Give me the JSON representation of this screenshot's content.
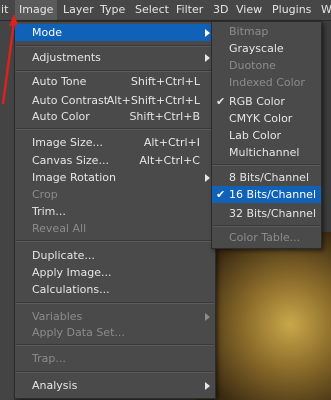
{
  "menubar": {
    "items": [
      {
        "label": "lit"
      },
      {
        "label": "Image"
      },
      {
        "label": "Layer"
      },
      {
        "label": "Type"
      },
      {
        "label": "Select"
      },
      {
        "label": "Filter"
      },
      {
        "label": "3D"
      },
      {
        "label": "View"
      },
      {
        "label": "Plugins"
      },
      {
        "label": "W"
      }
    ]
  },
  "image_menu": {
    "items": [
      {
        "label": "Mode"
      },
      {
        "label": "Adjustments"
      },
      {
        "label": "Auto Tone",
        "shortcut": "Shift+Ctrl+L"
      },
      {
        "label": "Auto Contrast",
        "shortcut": "Alt+Shift+Ctrl+L"
      },
      {
        "label": "Auto Color",
        "shortcut": "Shift+Ctrl+B"
      },
      {
        "label": "Image Size...",
        "shortcut": "Alt+Ctrl+I"
      },
      {
        "label": "Canvas Size...",
        "shortcut": "Alt+Ctrl+C"
      },
      {
        "label": "Image Rotation"
      },
      {
        "label": "Crop"
      },
      {
        "label": "Trim..."
      },
      {
        "label": "Reveal All"
      },
      {
        "label": "Duplicate..."
      },
      {
        "label": "Apply Image..."
      },
      {
        "label": "Calculations..."
      },
      {
        "label": "Variables"
      },
      {
        "label": "Apply Data Set..."
      },
      {
        "label": "Trap..."
      },
      {
        "label": "Analysis"
      }
    ]
  },
  "mode_submenu": {
    "items": [
      {
        "label": "Bitmap"
      },
      {
        "label": "Grayscale"
      },
      {
        "label": "Duotone"
      },
      {
        "label": "Indexed Color"
      },
      {
        "label": "RGB Color"
      },
      {
        "label": "CMYK Color"
      },
      {
        "label": "Lab Color"
      },
      {
        "label": "Multichannel"
      },
      {
        "label": "8 Bits/Channel"
      },
      {
        "label": "16 Bits/Channel"
      },
      {
        "label": "32 Bits/Channel"
      },
      {
        "label": "Color Table..."
      }
    ],
    "check_glyph": "✔"
  },
  "colors": {
    "highlight": "#0f62b8",
    "annotation": "#e0201b"
  }
}
